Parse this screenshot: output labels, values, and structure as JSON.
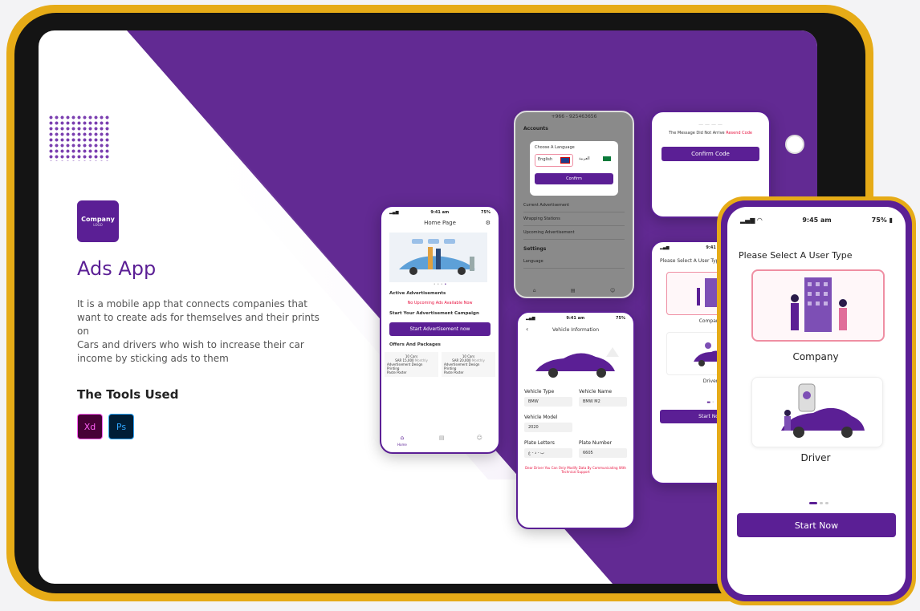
{
  "brand": {
    "purple": "#5b1f95",
    "gold": "#e6ab17",
    "accent_red": "#e8123f"
  },
  "logo": {
    "name": "Company",
    "tagline": "LOGO"
  },
  "title": "Ads App",
  "description": [
    "It is a mobile app that connects companies that",
    "want to create ads for themselves and their prints",
    "on",
    "Cars and drivers who wish to increase their car",
    "income by sticking ads to them"
  ],
  "tools": {
    "title": "The Tools Used",
    "items": [
      "Xd",
      "Ps"
    ]
  },
  "settings_phone": {
    "phone": "+966 - 925463656",
    "section_accounts": "Accounts",
    "dialog_title": "Choose A Language",
    "lang_en": "English",
    "lang_ar": "العربية",
    "confirm": "Confirm",
    "current_ad": "Current Advertisement",
    "wrapping": "Wrapping Stations",
    "upcoming": "Upcoming Advertisement",
    "section_settings": "Settings",
    "language": "Language",
    "nav_profile": "Profile"
  },
  "otp_phone": {
    "message": "The Message Did Not Arrive",
    "resend": "Resend Code",
    "confirm": "Confirm Code"
  },
  "home_phone": {
    "time": "9:41 am",
    "battery": "75%",
    "title": "Home Page",
    "active_ads": "Active Advertisements",
    "no_ads": "No Upcoming Ads Available Now",
    "start_campaign": "Start Your Advertisement Campaign",
    "start_btn": "Start Advertisement now",
    "offers": "Offers And Packages",
    "pkg1": {
      "title": "10 Cars",
      "price": "SAR 15,000",
      "per": "Monthly",
      "f1": "Advertisement Design",
      "f2": "Printing",
      "f3": "Paste Poster"
    },
    "pkg2": {
      "title": "10 Cars",
      "price": "SAR 20,000",
      "per": "Monthly",
      "f1": "Advertisement Design",
      "f2": "Printing",
      "f3": "Paste Poster"
    },
    "nav_home": "Home"
  },
  "vehicle_phone": {
    "time": "9:41 am",
    "battery": "75%",
    "title": "Vehicle Information",
    "type_label": "Vehicle Type",
    "type_value": "BMW",
    "name_label": "Vehicle Name",
    "name_value": "BMW M2",
    "model_label": "Vehicle Model",
    "model_value": "2020",
    "letters_label": "Plate Letters",
    "letters_value": "ب - د - ع",
    "number_label": "Plate Number",
    "number_value": "6605",
    "note": "Dear Driver You Can Only Modify Data By Communicating With Technical Support"
  },
  "usertype_small": {
    "time": "9:41 am",
    "title": "Please Select A User Type",
    "company": "Company",
    "driver": "Driver",
    "start": "Start Now"
  },
  "usertype_big": {
    "time": "9:45 am",
    "battery": "75%",
    "title": "Please Select A User Type",
    "company": "Company",
    "driver": "Driver",
    "start": "Start Now"
  }
}
